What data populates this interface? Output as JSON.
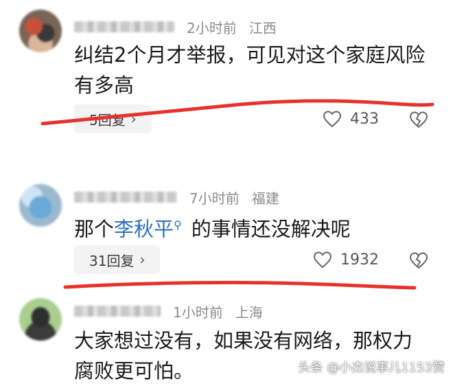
{
  "comments": [
    {
      "time": "2小时前",
      "location": "江西",
      "text_line1": "纠结2个月才举报，可见对这个家庭风险",
      "text_line2": "有多高",
      "replies": "5回复",
      "likes": "433"
    },
    {
      "time": "7小时前",
      "location": "福建",
      "text_prefix": "那个",
      "link_text": "李秋平",
      "text_suffix": "的事情还没解决呢",
      "replies": "31回复",
      "likes": "1932"
    },
    {
      "time": "1小时前",
      "location": "上海",
      "text_line1": "大家想过没有，如果没有网络，那权力",
      "text_line2": "腐败更可怕。"
    }
  ],
  "icons": {
    "like": "heart-outline-icon",
    "dislike": "broken-heart-icon",
    "chevron": "chevron-right-icon",
    "search": "search-icon"
  },
  "colors": {
    "annotation_red": "#e8312a",
    "link_blue": "#2b6fbf"
  },
  "watermark": "头条 @小杰说事儿1153赞"
}
